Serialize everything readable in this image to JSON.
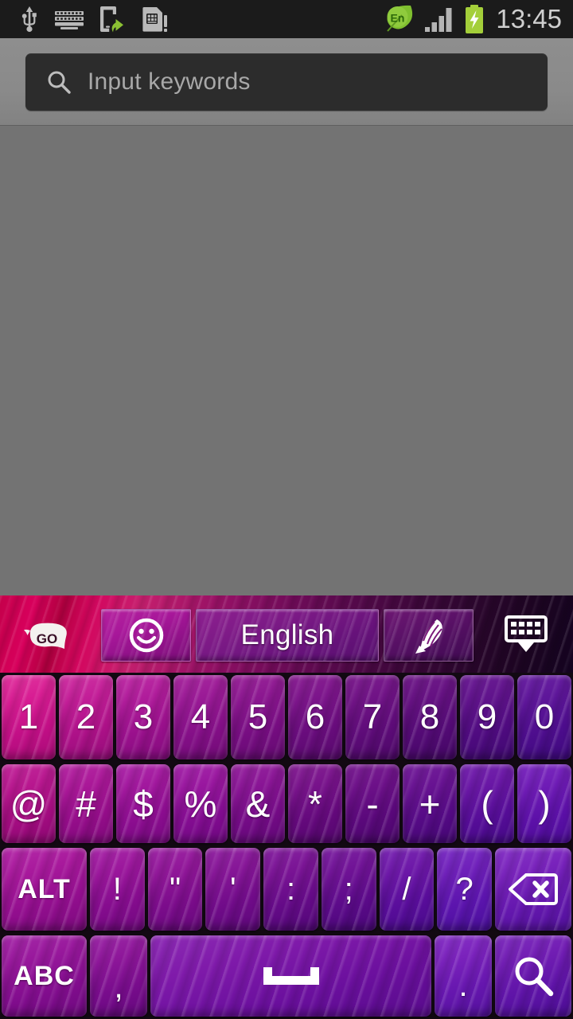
{
  "statusbar": {
    "time": "13:45",
    "left_icons": [
      {
        "name": "usb-icon",
        "label": "USB connected"
      },
      {
        "name": "keyboard-icon",
        "label": "Input method"
      },
      {
        "name": "phone-transfer-icon",
        "label": "Phone transfer"
      },
      {
        "name": "sim-card-alert-icon",
        "label": "SIM card alert"
      }
    ],
    "right_icons": [
      {
        "name": "language-en-icon",
        "label": "En"
      },
      {
        "name": "signal-bars-icon",
        "label": "Signal strength"
      },
      {
        "name": "battery-charging-icon",
        "label": "Battery charging"
      }
    ],
    "language_badge": "En",
    "colors": {
      "bar_bg": "#1b1b1b",
      "accent_green": "#8bc133",
      "clock": "#cfcfcf"
    }
  },
  "header": {
    "search": {
      "placeholder": "Input keywords",
      "value": "",
      "icon": "search-icon"
    }
  },
  "keyboard": {
    "toolbar": {
      "logo": {
        "name": "go-keyboard-logo",
        "text": "GO"
      },
      "emoji_button": {
        "name": "emoji-button",
        "icon": "smiley-icon"
      },
      "language_button": {
        "name": "language-button",
        "label": "English"
      },
      "pen_button": {
        "name": "handwriting-button",
        "icon": "pen-icon"
      },
      "hide_button": {
        "name": "hide-keyboard-button",
        "icon": "keyboard-down-icon"
      }
    },
    "rows": [
      {
        "name": "number-row",
        "keys": [
          {
            "label": "1",
            "name": "key-1",
            "type": "digit"
          },
          {
            "label": "2",
            "name": "key-2",
            "type": "digit"
          },
          {
            "label": "3",
            "name": "key-3",
            "type": "digit"
          },
          {
            "label": "4",
            "name": "key-4",
            "type": "digit"
          },
          {
            "label": "5",
            "name": "key-5",
            "type": "digit"
          },
          {
            "label": "6",
            "name": "key-6",
            "type": "digit"
          },
          {
            "label": "7",
            "name": "key-7",
            "type": "digit"
          },
          {
            "label": "8",
            "name": "key-8",
            "type": "digit"
          },
          {
            "label": "9",
            "name": "key-9",
            "type": "digit"
          },
          {
            "label": "0",
            "name": "key-0",
            "type": "digit"
          }
        ]
      },
      {
        "name": "symbol-row-1",
        "keys": [
          {
            "label": "@",
            "name": "key-at",
            "type": "symbol"
          },
          {
            "label": "#",
            "name": "key-hash",
            "type": "symbol"
          },
          {
            "label": "$",
            "name": "key-dollar",
            "type": "symbol"
          },
          {
            "label": "%",
            "name": "key-percent",
            "type": "symbol"
          },
          {
            "label": "&",
            "name": "key-ampersand",
            "type": "symbol"
          },
          {
            "label": "*",
            "name": "key-asterisk",
            "type": "symbol"
          },
          {
            "label": "-",
            "name": "key-minus",
            "type": "symbol"
          },
          {
            "label": "+",
            "name": "key-plus",
            "type": "symbol"
          },
          {
            "label": "(",
            "name": "key-paren-open",
            "type": "symbol"
          },
          {
            "label": ")",
            "name": "key-paren-close",
            "type": "symbol"
          }
        ]
      },
      {
        "name": "symbol-row-2",
        "keys": [
          {
            "label": "ALT",
            "name": "key-alt",
            "type": "modifier"
          },
          {
            "label": "!",
            "name": "key-exclamation",
            "type": "symbol"
          },
          {
            "label": "\"",
            "name": "key-quote-double",
            "type": "symbol"
          },
          {
            "label": "'",
            "name": "key-quote-single",
            "type": "symbol"
          },
          {
            "label": ":",
            "name": "key-colon",
            "type": "symbol"
          },
          {
            "label": ";",
            "name": "key-semicolon",
            "type": "symbol"
          },
          {
            "label": "/",
            "name": "key-slash",
            "type": "symbol"
          },
          {
            "label": "?",
            "name": "key-question",
            "type": "symbol"
          },
          {
            "label": "",
            "name": "key-backspace",
            "type": "backspace",
            "icon": "backspace-icon"
          }
        ]
      },
      {
        "name": "bottom-row",
        "keys": [
          {
            "label": "ABC",
            "name": "key-abc",
            "type": "modifier"
          },
          {
            "label": ",",
            "name": "key-comma",
            "type": "symbol"
          },
          {
            "label": "",
            "name": "key-space",
            "type": "space",
            "icon": "space-icon"
          },
          {
            "label": ".",
            "name": "key-period",
            "type": "symbol"
          },
          {
            "label": "",
            "name": "key-search-enter",
            "type": "enter",
            "icon": "search-icon"
          }
        ]
      }
    ],
    "colors": {
      "key_pink": "#d81d93",
      "key_purple": "#5c10a8",
      "toolbar_crimson": "#c4004a",
      "toolbar_dark": "#140320",
      "key_text": "#ffffff"
    }
  }
}
